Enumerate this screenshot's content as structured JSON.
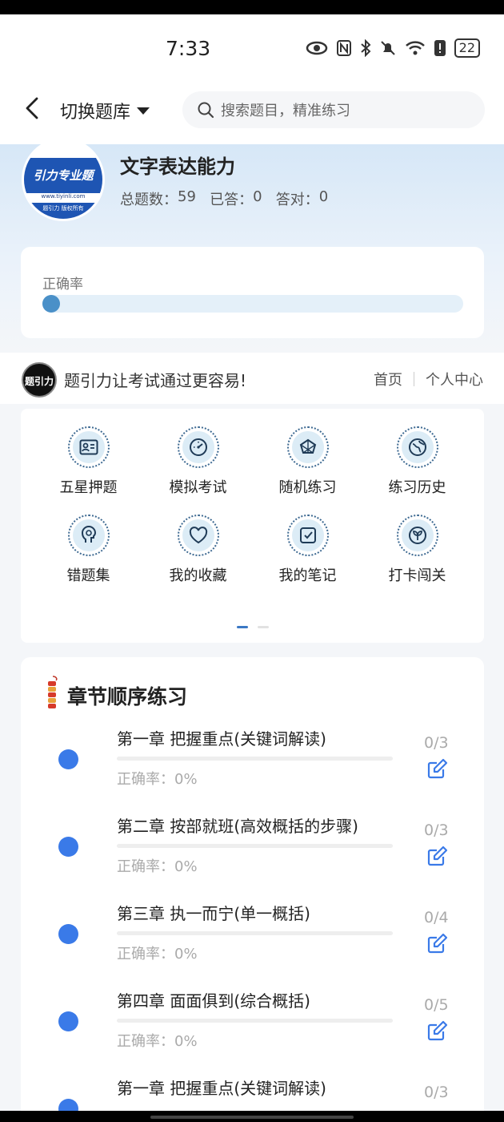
{
  "status": {
    "time": "7:33",
    "battery": "22"
  },
  "header": {
    "switch_label": "切换题库",
    "search_placeholder": "搜索题目，精准练习"
  },
  "subject": {
    "title": "文字表达能力",
    "total_label": "总题数：",
    "total": "59",
    "answered_label": "已答：",
    "answered": "0",
    "correct_label": "答对：",
    "correct": "0",
    "logo_text": "引力专业题",
    "logo_url": "www.tiyinli.com",
    "logo_bottom": "题引力 版权所有"
  },
  "accuracy": {
    "label": "正确率",
    "value": 0
  },
  "brand": {
    "slogan": "题引力让考试通过更容易!",
    "home": "首页",
    "profile": "个人中心",
    "logo_text": "题引力"
  },
  "menu": [
    {
      "label": "五星押题",
      "icon": "id-card-icon"
    },
    {
      "label": "模拟考试",
      "icon": "gauge-icon"
    },
    {
      "label": "随机练习",
      "icon": "shuffle-icon"
    },
    {
      "label": "练习历史",
      "icon": "globe-icon"
    },
    {
      "label": "错题集",
      "icon": "head-icon"
    },
    {
      "label": "我的收藏",
      "icon": "heart-icon"
    },
    {
      "label": "我的笔记",
      "icon": "note-icon"
    },
    {
      "label": "打卡闯关",
      "icon": "sprout-icon"
    }
  ],
  "chapters": {
    "title": "章节顺序练习",
    "items": [
      {
        "name": "第一章 把握重点(关键词解读)",
        "accuracy": "正确率：0%",
        "count": "0/3"
      },
      {
        "name": "第二章 按部就班(高效概括的步骤)",
        "accuracy": "正确率：0%",
        "count": "0/3"
      },
      {
        "name": "第三章 执一而宁(单一概括)",
        "accuracy": "正确率：0%",
        "count": "0/4"
      },
      {
        "name": "第四章 面面俱到(综合概括)",
        "accuracy": "正确率：0%",
        "count": "0/5"
      },
      {
        "name": "第一章 把握重点(关键词解读)",
        "accuracy": "",
        "count": "0/3"
      }
    ]
  }
}
